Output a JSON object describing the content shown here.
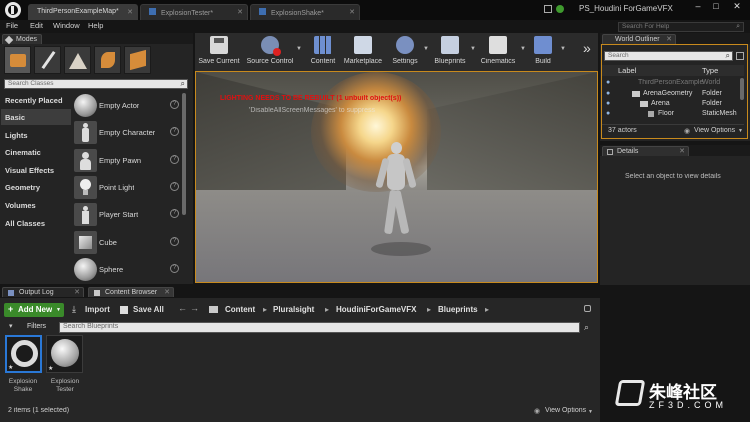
{
  "window": {
    "app_logo": "unreal-logo-icon",
    "tabs": [
      "ThirdPersonExampleMap*",
      "ExplosionTester*",
      "ExplosionShake*"
    ],
    "project_name": "PS_Houdini ForGameVFX",
    "help_search_placeholder": "Search For Help"
  },
  "menu": [
    "File",
    "Edit",
    "Window",
    "Help"
  ],
  "modes": {
    "title": "Modes",
    "search_placeholder": "Search Classes",
    "categories": [
      "Recently Placed",
      "Basic",
      "Lights",
      "Cinematic",
      "Visual Effects",
      "Geometry",
      "Volumes",
      "All Classes"
    ],
    "selected_category": "Basic",
    "items": [
      "Empty Actor",
      "Empty Character",
      "Empty Pawn",
      "Point Light",
      "Player Start",
      "Cube",
      "Sphere"
    ]
  },
  "toolbar": {
    "buttons": [
      "Save Current",
      "Source Control",
      "Content",
      "Marketplace",
      "Settings",
      "Blueprints",
      "Cinematics",
      "Build"
    ],
    "more": "»"
  },
  "viewport": {
    "warning_text": "LIGHTING NEEDS TO BE REBUILT (1 unbuilt object(s))",
    "hint_text": "'DisableAllScreenMessages' to suppress",
    "warning_color": "#e01010"
  },
  "outliner": {
    "title": "World Outliner",
    "search_placeholder": "Search",
    "col_label": "Label",
    "col_type": "Type",
    "rows": [
      {
        "label": "ThirdPersonExampleMap",
        "type": "World"
      },
      {
        "label": "ArenaGeometry",
        "type": "Folder"
      },
      {
        "label": "Arena",
        "type": "Folder"
      },
      {
        "label": "Floor",
        "type": "StaticMesh"
      }
    ],
    "actor_count": "37 actors",
    "view_options": "View Options"
  },
  "details": {
    "title": "Details",
    "empty_text": "Select an object to view details"
  },
  "bottom_tabs": [
    "Output Log",
    "Content Browser"
  ],
  "content_browser": {
    "add_new": "Add New",
    "import": "Import",
    "save_all": "Save All",
    "path": [
      "Content",
      "Pluralsight",
      "HoudiniForGameVFX",
      "Blueprints"
    ],
    "filters": "Filters",
    "search_placeholder": "Search Blueprints",
    "assets": [
      {
        "line1": "Explosion",
        "line2": "Shake"
      },
      {
        "line1": "Explosion",
        "line2": "Tester"
      }
    ],
    "status": "2 items (1 selected)",
    "view_options": "View Options"
  },
  "watermark": {
    "cn_text": "朱峰社区",
    "url_text": "ZF3D.COM"
  },
  "colors": {
    "accent_blue": "#2f74c9",
    "add_new_green": "#3a8a2a",
    "selected_asset_border": "#2a78d6"
  }
}
